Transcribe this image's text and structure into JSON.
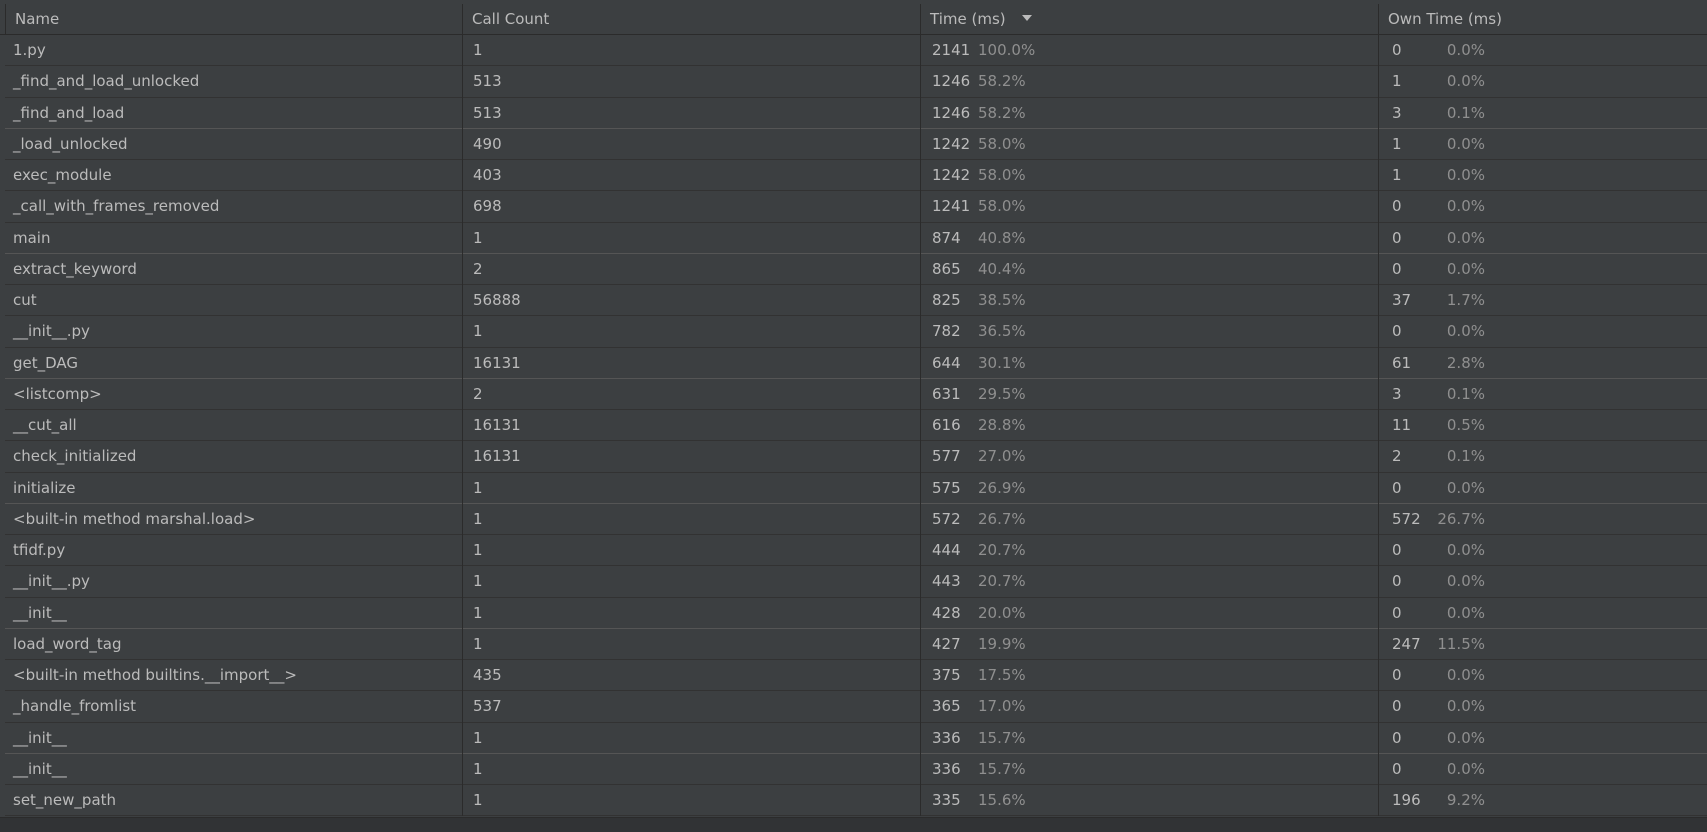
{
  "columns": {
    "name": "Name",
    "call_count": "Call Count",
    "time": "Time (ms)",
    "own_time": "Own Time (ms)",
    "sort_icon": "sort-descending-icon"
  },
  "rows": [
    {
      "name": "1.py",
      "count": "1",
      "time": "2141",
      "time_pct": "100.0%",
      "own": "0",
      "own_pct": "0.0%"
    },
    {
      "name": "_find_and_load_unlocked",
      "count": "513",
      "time": "1246",
      "time_pct": "58.2%",
      "own": "1",
      "own_pct": "0.0%"
    },
    {
      "name": "_find_and_load",
      "count": "513",
      "time": "1246",
      "time_pct": "58.2%",
      "own": "3",
      "own_pct": "0.1%"
    },
    {
      "name": "_load_unlocked",
      "count": "490",
      "time": "1242",
      "time_pct": "58.0%",
      "own": "1",
      "own_pct": "0.0%"
    },
    {
      "name": "exec_module",
      "count": "403",
      "time": "1242",
      "time_pct": "58.0%",
      "own": "1",
      "own_pct": "0.0%"
    },
    {
      "name": "_call_with_frames_removed",
      "count": "698",
      "time": "1241",
      "time_pct": "58.0%",
      "own": "0",
      "own_pct": "0.0%"
    },
    {
      "name": "main",
      "count": "1",
      "time": "874",
      "time_pct": "40.8%",
      "own": "0",
      "own_pct": "0.0%"
    },
    {
      "name": "extract_keyword",
      "count": "2",
      "time": "865",
      "time_pct": "40.4%",
      "own": "0",
      "own_pct": "0.0%"
    },
    {
      "name": "cut",
      "count": "56888",
      "time": "825",
      "time_pct": "38.5%",
      "own": "37",
      "own_pct": "1.7%"
    },
    {
      "name": "__init__.py",
      "count": "1",
      "time": "782",
      "time_pct": "36.5%",
      "own": "0",
      "own_pct": "0.0%"
    },
    {
      "name": "get_DAG",
      "count": "16131",
      "time": "644",
      "time_pct": "30.1%",
      "own": "61",
      "own_pct": "2.8%"
    },
    {
      "name": "<listcomp>",
      "count": "2",
      "time": "631",
      "time_pct": "29.5%",
      "own": "3",
      "own_pct": "0.1%"
    },
    {
      "name": "__cut_all",
      "count": "16131",
      "time": "616",
      "time_pct": "28.8%",
      "own": "11",
      "own_pct": "0.5%"
    },
    {
      "name": "check_initialized",
      "count": "16131",
      "time": "577",
      "time_pct": "27.0%",
      "own": "2",
      "own_pct": "0.1%"
    },
    {
      "name": "initialize",
      "count": "1",
      "time": "575",
      "time_pct": "26.9%",
      "own": "0",
      "own_pct": "0.0%"
    },
    {
      "name": "<built-in method marshal.load>",
      "count": "1",
      "time": "572",
      "time_pct": "26.7%",
      "own": "572",
      "own_pct": "26.7%"
    },
    {
      "name": "tfidf.py",
      "count": "1",
      "time": "444",
      "time_pct": "20.7%",
      "own": "0",
      "own_pct": "0.0%"
    },
    {
      "name": "__init__.py",
      "count": "1",
      "time": "443",
      "time_pct": "20.7%",
      "own": "0",
      "own_pct": "0.0%"
    },
    {
      "name": "__init__",
      "count": "1",
      "time": "428",
      "time_pct": "20.0%",
      "own": "0",
      "own_pct": "0.0%"
    },
    {
      "name": "load_word_tag",
      "count": "1",
      "time": "427",
      "time_pct": "19.9%",
      "own": "247",
      "own_pct": "11.5%"
    },
    {
      "name": "<built-in method builtins.__import__>",
      "count": "435",
      "time": "375",
      "time_pct": "17.5%",
      "own": "0",
      "own_pct": "0.0%"
    },
    {
      "name": "_handle_fromlist",
      "count": "537",
      "time": "365",
      "time_pct": "17.0%",
      "own": "0",
      "own_pct": "0.0%"
    },
    {
      "name": "__init__",
      "count": "1",
      "time": "336",
      "time_pct": "15.7%",
      "own": "0",
      "own_pct": "0.0%"
    },
    {
      "name": "__init__",
      "count": "1",
      "time": "336",
      "time_pct": "15.7%",
      "own": "0",
      "own_pct": "0.0%"
    },
    {
      "name": "set_new_path",
      "count": "1",
      "time": "335",
      "time_pct": "15.6%",
      "own": "196",
      "own_pct": "9.2%"
    }
  ],
  "colors": {
    "background": "#3c3f41",
    "text": "#bbbbbb",
    "percent_text": "#8f8f8f",
    "grid": "#2b2b2b"
  }
}
